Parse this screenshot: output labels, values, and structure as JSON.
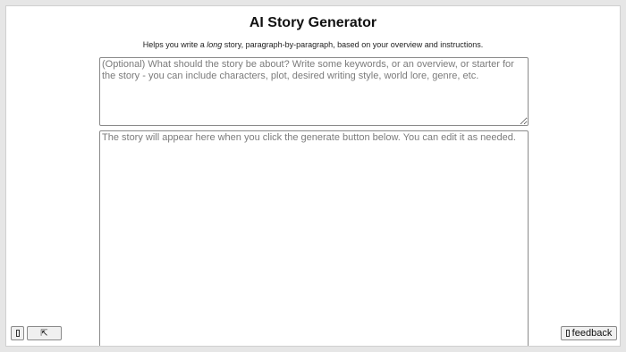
{
  "page": {
    "title": "AI Story Generator",
    "subtitle_before": "Helps you write a ",
    "subtitle_emphasis": "long",
    "subtitle_after": " story, paragraph-by-paragraph, based on your overview and instructions."
  },
  "overview_input": {
    "value": "",
    "placeholder": "(Optional) What should the story be about? Write some keywords, or an overview, or starter for the story - you can include characters, plot, desired writing style, world lore, genre, etc."
  },
  "story_output": {
    "value": "",
    "placeholder": "The story will appear here when you click the generate button below. You can edit it as needed."
  },
  "bottom_bar": {
    "menu_icon": "menu-icon",
    "expand_label": "⇱",
    "expand_icon": "expand-icon",
    "feedback_label": "feedback",
    "feedback_icon": "feedback-icon"
  }
}
